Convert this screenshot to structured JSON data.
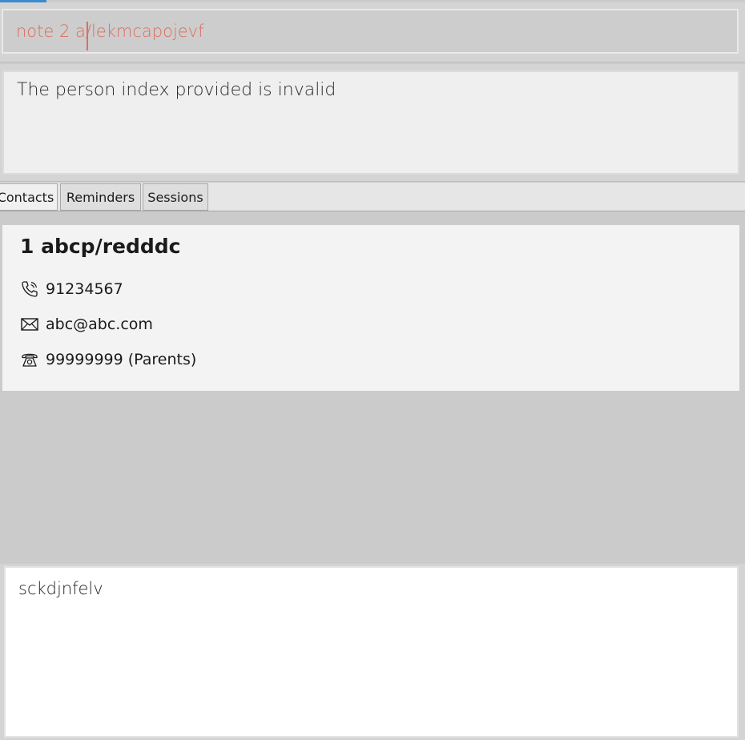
{
  "command": {
    "value": "note 2 a/lekmcapojevf",
    "text_color": "#d9705f"
  },
  "result": {
    "message": "The person index provided is invalid"
  },
  "tabs": [
    {
      "label": "Contacts",
      "selected": true
    },
    {
      "label": "Reminders",
      "selected": false
    },
    {
      "label": "Sessions",
      "selected": false
    }
  ],
  "person": {
    "name": "1 abcp/redddc",
    "phone": "91234567",
    "phone_icon": "phone-icon",
    "email": "abc@abc.com",
    "email_icon": "envelope-icon",
    "parent_phone": "99999999 (Parents)",
    "parent_phone_icon": "telephone-icon"
  },
  "notes": {
    "text": "sckdjnfelv"
  },
  "colors": {
    "accent": "#3b8bd0",
    "background": "#cbcbcb",
    "card": "#f3f3f3"
  }
}
